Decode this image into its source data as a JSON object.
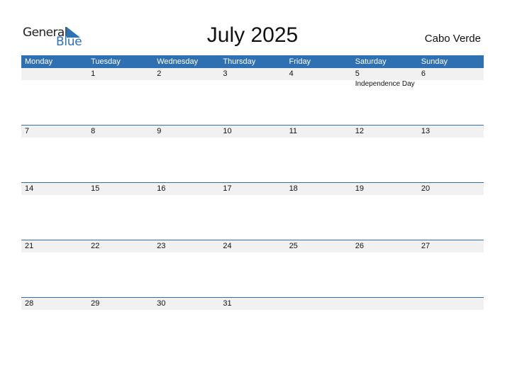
{
  "logo": {
    "text_top": "General",
    "text_bottom": "Blue",
    "icon": "triangle-flag-icon",
    "brand_color": "#2a73b8"
  },
  "title": "July 2025",
  "country": "Cabo Verde",
  "colors": {
    "header_bg": "#2e70b2",
    "row_band": "#f1f1f1"
  },
  "weekdays": [
    "Monday",
    "Tuesday",
    "Wednesday",
    "Thursday",
    "Friday",
    "Saturday",
    "Sunday"
  ],
  "weeks": [
    [
      {
        "day": ""
      },
      {
        "day": "1"
      },
      {
        "day": "2"
      },
      {
        "day": "3"
      },
      {
        "day": "4"
      },
      {
        "day": "5",
        "event": "Independence Day"
      },
      {
        "day": "6"
      }
    ],
    [
      {
        "day": "7"
      },
      {
        "day": "8"
      },
      {
        "day": "9"
      },
      {
        "day": "10"
      },
      {
        "day": "11"
      },
      {
        "day": "12"
      },
      {
        "day": "13"
      }
    ],
    [
      {
        "day": "14"
      },
      {
        "day": "15"
      },
      {
        "day": "16"
      },
      {
        "day": "17"
      },
      {
        "day": "18"
      },
      {
        "day": "19"
      },
      {
        "day": "20"
      }
    ],
    [
      {
        "day": "21"
      },
      {
        "day": "22"
      },
      {
        "day": "23"
      },
      {
        "day": "24"
      },
      {
        "day": "25"
      },
      {
        "day": "26"
      },
      {
        "day": "27"
      }
    ],
    [
      {
        "day": "28"
      },
      {
        "day": "29"
      },
      {
        "day": "30"
      },
      {
        "day": "31"
      },
      {
        "day": ""
      },
      {
        "day": ""
      },
      {
        "day": ""
      }
    ]
  ]
}
